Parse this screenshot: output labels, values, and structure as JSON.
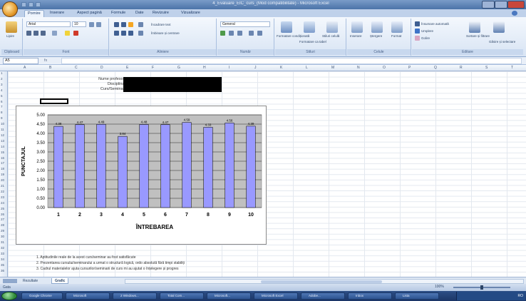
{
  "window": {
    "title": "4_Evaluare_EIC_curs_(Mod compatibilitate) - Microsoft Excel"
  },
  "ribbon": {
    "tabs": [
      "Pornire",
      "Inserare",
      "Aspect pagină",
      "Formule",
      "Date",
      "Revizuire",
      "Vizualizare"
    ],
    "groups": [
      "Clipboard",
      "Font",
      "Aliniere",
      "Număr",
      "Stiluri",
      "Celule",
      "Editare"
    ],
    "font_name": "Arial",
    "font_size": "10",
    "number_format": "General",
    "buttons": {
      "paste": "Lipire",
      "wrap_text": "Încadrare text",
      "merge_center": "Îmbinare și centrare",
      "conditional_formatting": "Formatare condiționată",
      "format_as_table": "Formatare ca tabel",
      "cell_styles": "Stiluri celulă",
      "insert": "Inserare",
      "delete": "Ștergere",
      "format": "Format",
      "autosum": "Însumare automată",
      "fill": "Umplere",
      "clear": "Golire",
      "sort_filter": "Sortare și filtrare",
      "find_select": "Găsire și selectare"
    }
  },
  "formula_bar": {
    "name_box": "A5",
    "fx_label": "fx",
    "value": ""
  },
  "grid": {
    "columns": [
      "A",
      "B",
      "C",
      "D",
      "E",
      "F",
      "G",
      "H",
      "I",
      "J",
      "K",
      "L",
      "M",
      "N",
      "O",
      "P",
      "Q",
      "R",
      "S",
      "T"
    ],
    "rows": [
      "1",
      "2",
      "3",
      "4",
      "5",
      "6",
      "7",
      "8",
      "9",
      "10",
      "11",
      "12",
      "13",
      "14",
      "15",
      "16",
      "17",
      "18",
      "19",
      "20",
      "21",
      "22",
      "23",
      "24",
      "25",
      "26",
      "27",
      "28",
      "29",
      "30",
      "31",
      "32",
      "33",
      "34",
      "35",
      "36"
    ]
  },
  "form": {
    "labels": [
      "Nume profesor:",
      "Disciplina:",
      "Curs/Seminar:"
    ]
  },
  "chart_data": {
    "type": "bar",
    "categories": [
      "1",
      "2",
      "3",
      "4",
      "5",
      "6",
      "7",
      "8",
      "9",
      "10"
    ],
    "values": [
      4.38,
      4.47,
      4.49,
      3.84,
      4.48,
      4.47,
      4.59,
      4.33,
      4.56,
      4.39
    ],
    "data_labels": [
      "4.38",
      "4.47",
      "4.49",
      "3.84",
      "4.48",
      "4.47",
      "4.59",
      "4.33",
      "4.56",
      "4.39"
    ],
    "title": "",
    "xlabel": "ÎNTREBAREA",
    "ylabel": "PUNCTAJUL",
    "ylim": [
      0,
      5
    ],
    "yticks": [
      "0.00",
      "0.50",
      "1.00",
      "1.50",
      "2.00",
      "2.50",
      "3.00",
      "3.50",
      "4.00",
      "4.50",
      "5.00"
    ],
    "grid": true,
    "bar_color": "#9999ff",
    "plot_background": "#c0c0c0"
  },
  "notes": [
    "1. Aptitudinile reale de la acest curs/seminar au fost satisfăcute",
    "2. Prezentarea cursului/seminarului a urmat o structură logică, ordo absolută fără timpi stabiliți",
    "3. Cadrul materialelor ajuta cursurilor/seminarii de curs mi au ajutat o înțelegere și progres"
  ],
  "sheet_tabs": {
    "tabs": [
      "Rezultate",
      "Grafic"
    ],
    "active": "Grafic"
  },
  "status": {
    "ready": "Gata",
    "zoom": "100%"
  },
  "taskbar": {
    "items": [
      "Google Chrome",
      "Microsoft",
      "2 Windows...",
      "Total Com...",
      "Microsoft...",
      "Microsoft Excel",
      "Adobe...",
      "Inbox",
      "Lista"
    ],
    "clock": "RO"
  }
}
